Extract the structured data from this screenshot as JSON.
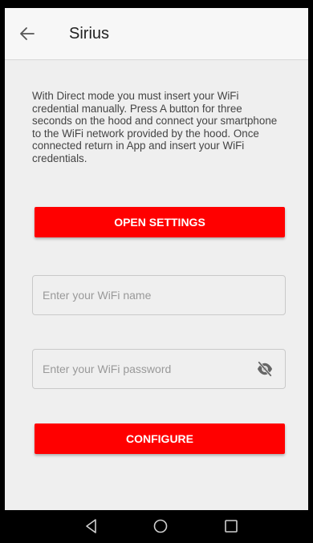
{
  "app_bar": {
    "title": "Sirius",
    "back_icon": "arrow-left-icon"
  },
  "main": {
    "description": "With Direct mode you must insert your WiFi credential manually. Press A button for three seconds on the hood and connect your smartphone to the WiFi network provided by the hood. Once connected return in App and insert your WiFi credentials.",
    "open_settings_label": "OPEN SETTINGS",
    "wifi_name": {
      "value": "",
      "placeholder": "Enter your WiFi name"
    },
    "wifi_password": {
      "value": "",
      "placeholder": "Enter your WiFi password",
      "visibility_icon": "eye-off-icon"
    },
    "configure_label": "CONFIGURE"
  },
  "nav_bar": {
    "icons": [
      "nav-back-icon",
      "nav-home-icon",
      "nav-recents-icon"
    ]
  },
  "colors": {
    "accent": "#ff0000",
    "background": "#efefef",
    "app_bar": "#f7f7f7"
  }
}
